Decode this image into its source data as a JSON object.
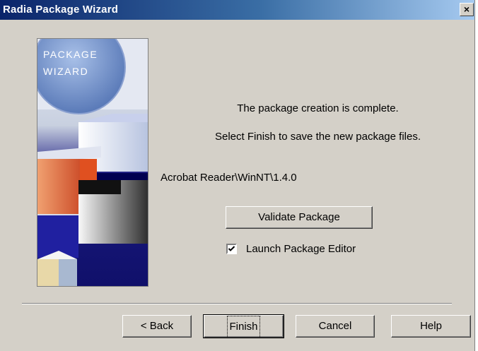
{
  "window": {
    "title": "Radia Package Wizard",
    "close_glyph": "×"
  },
  "side_panel": {
    "logo_text": "PACKAGE\nWIZARD"
  },
  "message": {
    "line1": "The package creation is complete.",
    "line2": "Select Finish to save the new package files."
  },
  "package_path": "Acrobat Reader\\WinNT\\1.4.0",
  "validate_button": "Validate Package",
  "launch_editor": {
    "label": "Launch Package Editor",
    "checked": true
  },
  "footer": {
    "back": "< Back",
    "finish": "Finish",
    "cancel": "Cancel",
    "help": "Help"
  }
}
